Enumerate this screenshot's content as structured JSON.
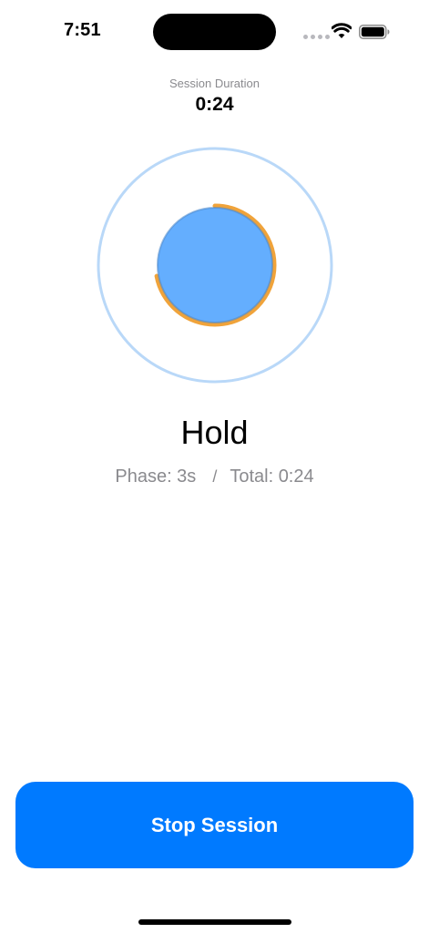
{
  "status_bar": {
    "time": "7:51",
    "icons": [
      "signal-dots-icon",
      "wifi-icon",
      "battery-icon"
    ]
  },
  "session": {
    "duration_label": "Session Duration",
    "duration_value": "0:24"
  },
  "breathing": {
    "phase": "Hold",
    "phase_label": "Phase: 3s",
    "separator": "/",
    "total_label": "Total: 0:24",
    "phase_progress": 0.72,
    "colors": {
      "outer_ring": "#b9d8f8",
      "inner_circle": "#64aefe",
      "progress_arc": "#f0a33a",
      "inner_outline": "#4a86c9"
    }
  },
  "actions": {
    "stop_label": "Stop Session",
    "accent": "#007aff"
  }
}
